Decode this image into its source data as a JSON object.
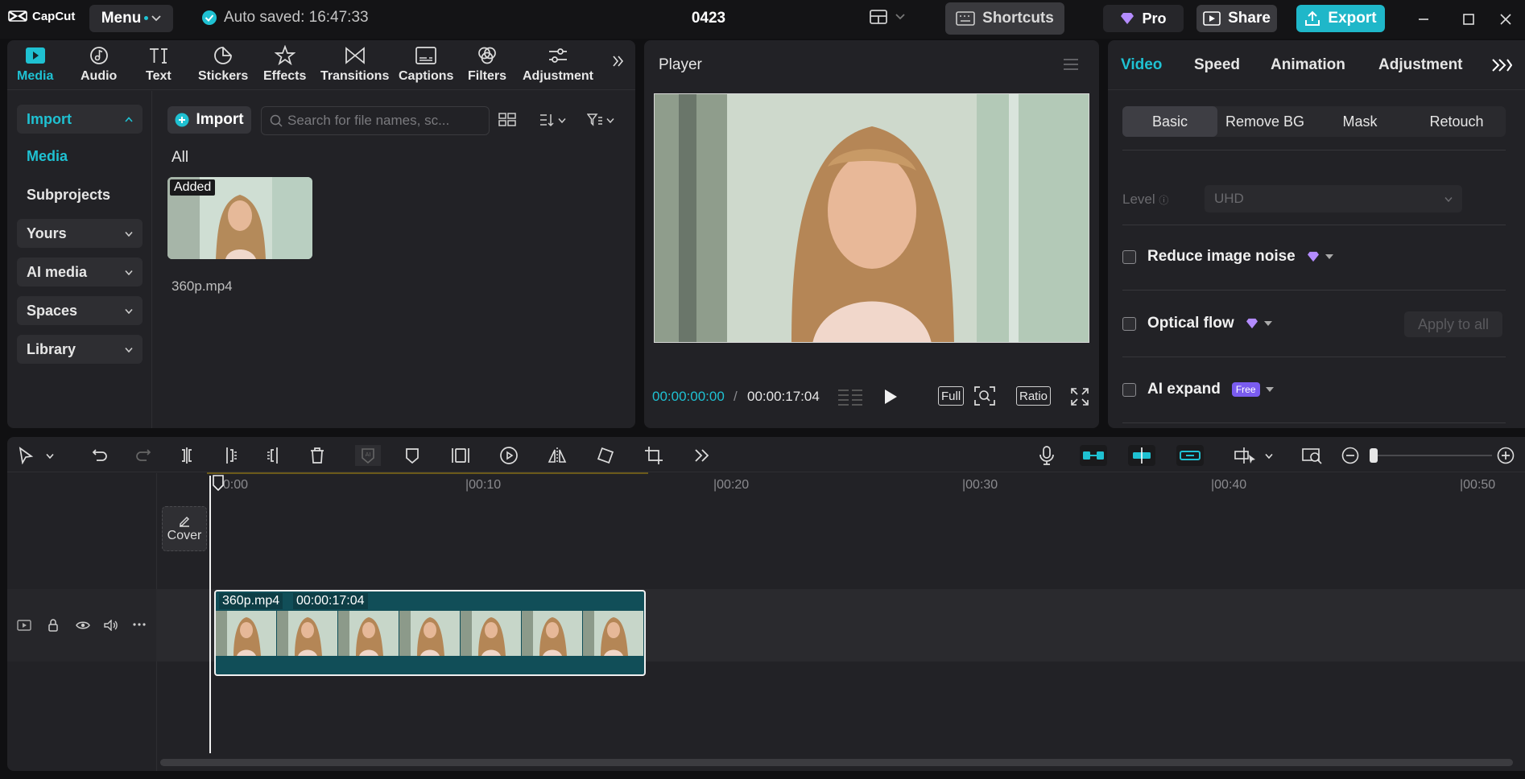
{
  "app": {
    "name": "CapCut",
    "project_title": "0423",
    "autosave": "Auto saved: 16:47:33",
    "menu_label": "Menu"
  },
  "header": {
    "shortcuts": "Shortcuts",
    "pro": "Pro",
    "share": "Share",
    "export": "Export"
  },
  "media": {
    "tabs": [
      {
        "label": "Media",
        "icon": "media-icon",
        "active": true
      },
      {
        "label": "Audio",
        "icon": "audio-icon"
      },
      {
        "label": "Text",
        "icon": "text-icon"
      },
      {
        "label": "Stickers",
        "icon": "stickers-icon"
      },
      {
        "label": "Effects",
        "icon": "effects-icon"
      },
      {
        "label": "Transitions",
        "icon": "transitions-icon"
      },
      {
        "label": "Captions",
        "icon": "captions-icon"
      },
      {
        "label": "Filters",
        "icon": "filters-icon"
      },
      {
        "label": "Adjustment",
        "icon": "adjustment-icon"
      }
    ],
    "sidebar": [
      {
        "label": "Import",
        "style": "accent-box"
      },
      {
        "label": "Media",
        "style": "accent"
      },
      {
        "label": "Subprojects",
        "style": "plain"
      },
      {
        "label": "Yours",
        "style": "box"
      },
      {
        "label": "AI media",
        "style": "box"
      },
      {
        "label": "Spaces",
        "style": "box"
      },
      {
        "label": "Library",
        "style": "box"
      }
    ],
    "import_button": "Import",
    "search_placeholder": "Search for file names, sc...",
    "filter_all": "All",
    "items": [
      {
        "badge": "Added",
        "name": "360p.mp4"
      }
    ]
  },
  "player": {
    "title": "Player",
    "current_time": "00:00:00:00",
    "separator": "/",
    "total_time": "00:00:17:04",
    "full": "Full",
    "ratio": "Ratio"
  },
  "properties": {
    "tabs": [
      "Video",
      "Speed",
      "Animation",
      "Adjustment"
    ],
    "subtabs": [
      "Basic",
      "Remove BG",
      "Mask",
      "Retouch"
    ],
    "level_label": "Level",
    "level_value": "UHD",
    "options": [
      {
        "label": "Reduce image noise",
        "pro": true
      },
      {
        "label": "Optical flow",
        "pro": true
      },
      {
        "label": "AI expand",
        "badge": "Free"
      }
    ],
    "apply_all": "Apply to all"
  },
  "timeline": {
    "ruler_labels": [
      "00:00",
      "|00:10",
      "|00:20",
      "|00:30",
      "|00:40",
      "|00:50"
    ],
    "clip_name": "360p.mp4",
    "clip_duration": "00:00:17:04",
    "cover_label": "Cover"
  },
  "colors": {
    "accent": "#1fc1d2",
    "clip": "#114e58",
    "panel": "#222226",
    "background": "#101012"
  }
}
